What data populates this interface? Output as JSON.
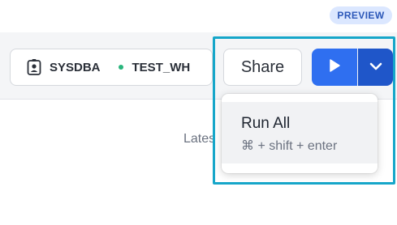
{
  "badge": {
    "label": "PREVIEW"
  },
  "toolbar": {
    "role": "SYSDBA",
    "warehouse": "TEST_WH",
    "share_label": "Share"
  },
  "background": {
    "partial_text": "Lates"
  },
  "run_menu": {
    "items": [
      {
        "label": "Run All",
        "shortcut": "⌘ + shift + enter"
      }
    ]
  },
  "colors": {
    "accent": "#2f6ff0",
    "accent_dark": "#1f56c9",
    "warehouse_status": "#29b57c",
    "highlight": "#16a6c9",
    "badge_bg": "#dbe7ff"
  },
  "icons": {
    "role": "user-badge-icon",
    "run": "play-icon",
    "run_options": "chevron-down-icon"
  }
}
